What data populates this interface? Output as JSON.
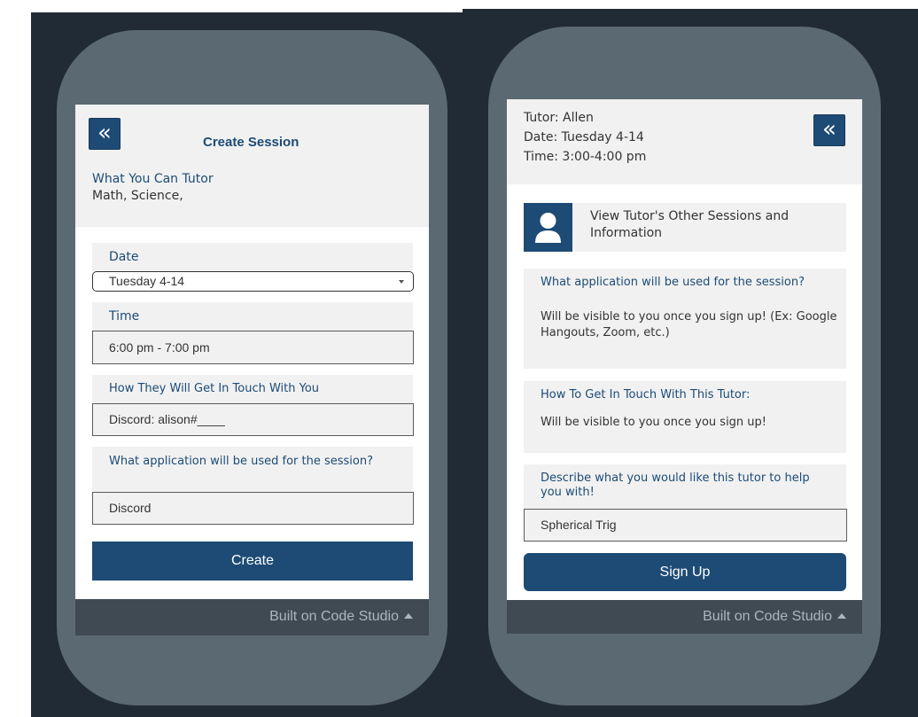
{
  "left": {
    "back_icon": "«",
    "title": "Create Session",
    "tutor_label": "What You Can Tutor",
    "tutor_subjects": "Math, Science,",
    "date_label": "Date",
    "date_value": "Tuesday 4-14",
    "time_label": "Time",
    "time_value": "6:00 pm - 7:00 pm",
    "contact_label": "How They Will Get In Touch With You",
    "contact_value": "Discord: alison#____",
    "app_label": "What application will be used for the session?",
    "app_value": "Discord",
    "create_button": "Create",
    "footer": "Built on Code Studio"
  },
  "right": {
    "tutor": "Tutor: Allen",
    "date": "Date: Tuesday 4-14",
    "time": "Time: 3:00-4:00 pm",
    "back_icon": "«",
    "view_sessions": "View Tutor's Other Sessions and Information",
    "app_question": "What application will be used for the session?",
    "app_answer": "Will be visible to you once you sign up! (Ex: Google Hangouts, Zoom, etc.)",
    "contact_question": "How To Get In Touch With This Tutor:",
    "contact_answer": "Will be visible to you once you sign up!",
    "describe_label": "Describe what you would like this tutor to help you with!",
    "describe_value": "Spherical Trig",
    "signup_button": "Sign Up",
    "footer": "Built on Code Studio"
  },
  "colors": {
    "accent": "#1d4b75",
    "phone": "#5b6a72",
    "background": "#212b35"
  }
}
